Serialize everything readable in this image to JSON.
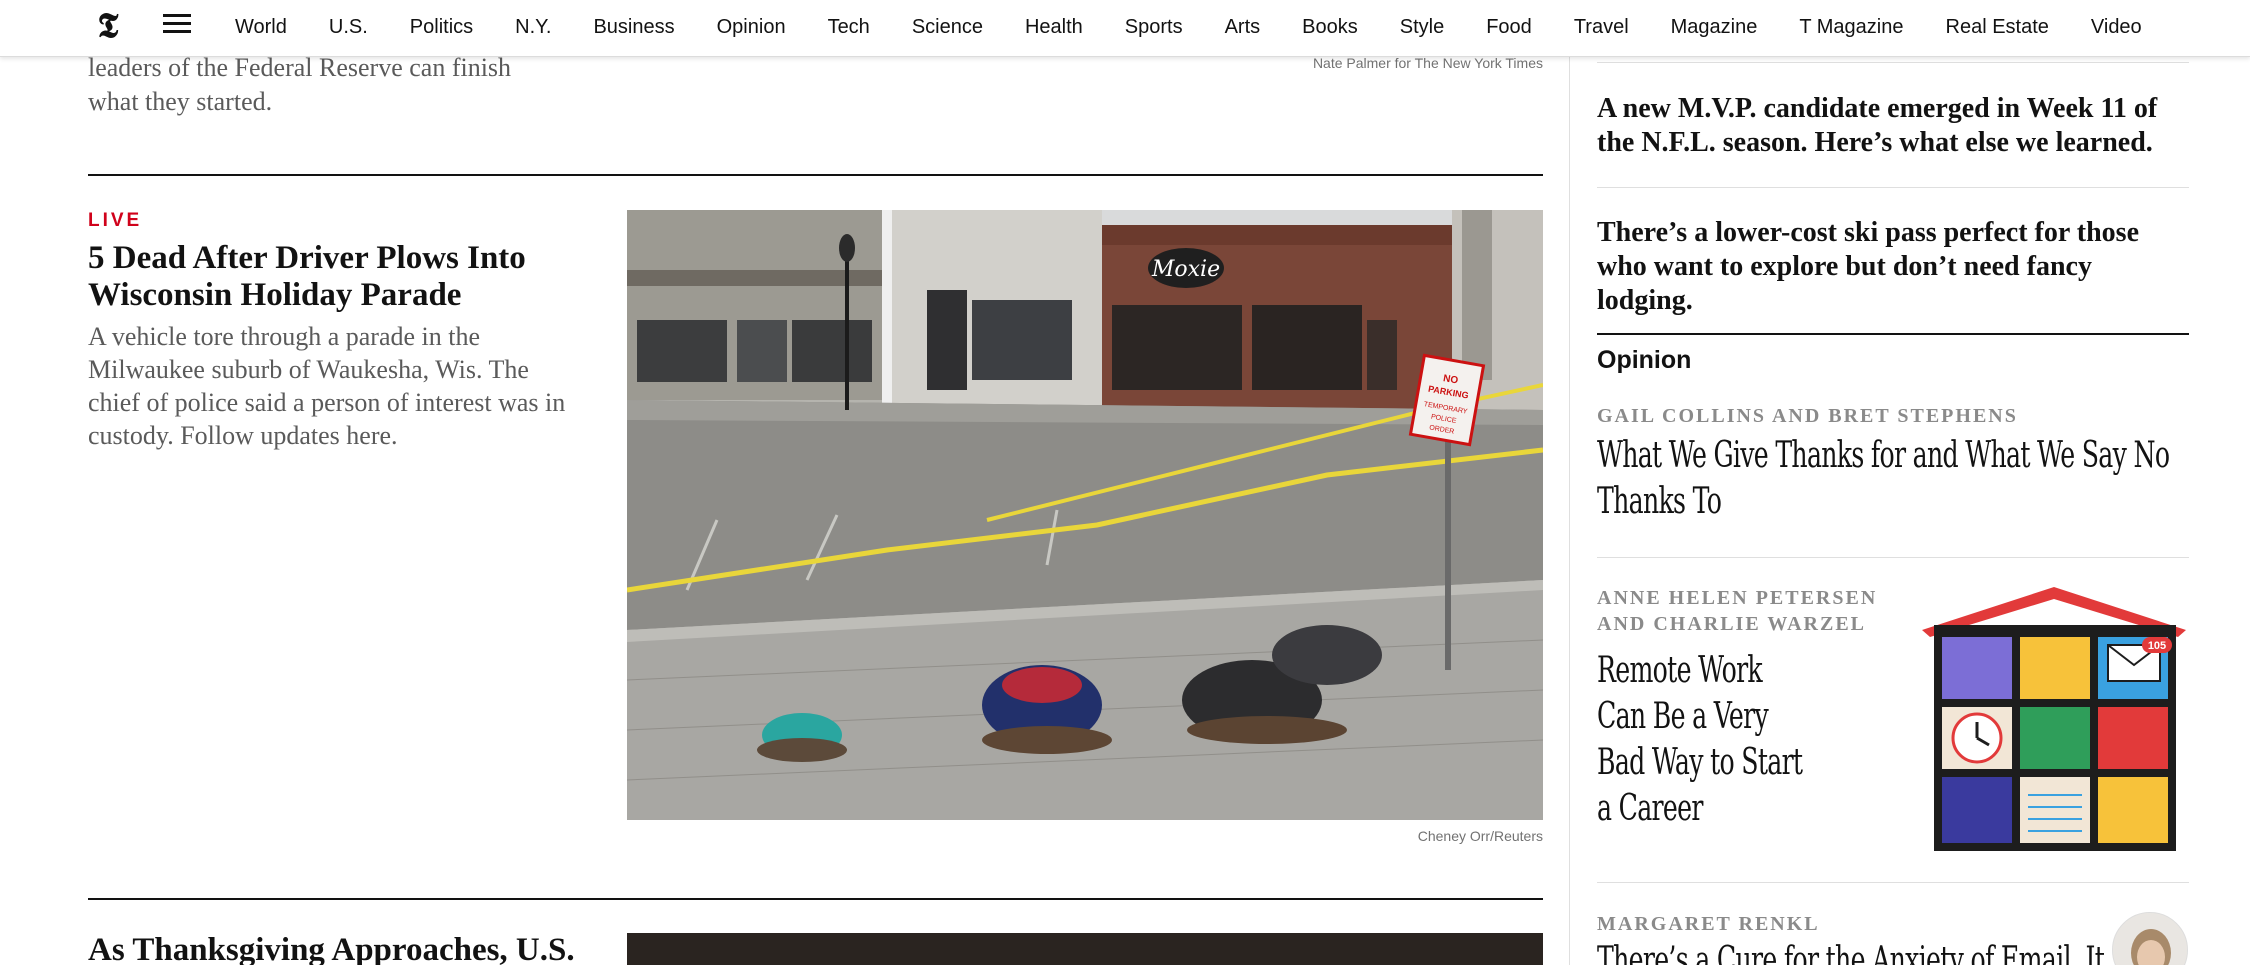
{
  "nav": {
    "logo_glyph": "𝕿",
    "links": [
      "World",
      "U.S.",
      "Politics",
      "N.Y.",
      "Business",
      "Opinion",
      "Tech",
      "Science",
      "Health",
      "Sports",
      "Arts",
      "Books",
      "Style",
      "Food",
      "Travel",
      "Magazine",
      "T Magazine",
      "Real Estate",
      "Video"
    ]
  },
  "main": {
    "prev_story": {
      "summary": "leaders of the Federal Reserve can finish what they started.",
      "photo_credit": "Nate Palmer for The New York Times"
    },
    "live_story": {
      "label": "LIVE",
      "headline": "5 Dead After Driver Plows Into Wisconsin Holiday Parade",
      "summary": "A vehicle tore through a parade in the Milwaukee suburb of Waukesha, Wis. The chief of police said a person of interest was in custody. Follow updates here.",
      "photo_credit": "Cheney Orr/Reuters",
      "sign_text": "NO PARKING TEMPORARY POLICE ORDER",
      "storefront_sign": "Moxie"
    },
    "next_story": {
      "headline": "As Thanksgiving Approaches, U.S."
    }
  },
  "sidebar": {
    "stories": [
      {
        "headline": "A new M.V.P. candidate emerged in Week 11 of the N.F.L. season. Here’s what else we learned."
      },
      {
        "headline": "There’s a lower-cost ski pass perfect for those who want to explore but don’t need fancy lodging."
      }
    ],
    "opinion": {
      "section_label": "Opinion",
      "items": [
        {
          "byline": "GAIL COLLINS AND BRET STEPHENS",
          "headline": "What We Give Thanks for and What We Say No Thanks To"
        },
        {
          "byline_line1": "ANNE HELEN PETERSEN",
          "byline_line2": "AND CHARLIE WARZEL",
          "headline": "Remote Work Can Be a Very Bad Way to Start a Career",
          "mail_count": "105"
        },
        {
          "byline": "MARGARET RENKL",
          "headline": "There’s a Cure for the Anxiety of Email. It"
        }
      ]
    }
  },
  "colors": {
    "live_red": "#d0021b",
    "text": "#121212",
    "summary_gray": "#5a5a5a",
    "byline_gray": "#8a8a8a"
  }
}
